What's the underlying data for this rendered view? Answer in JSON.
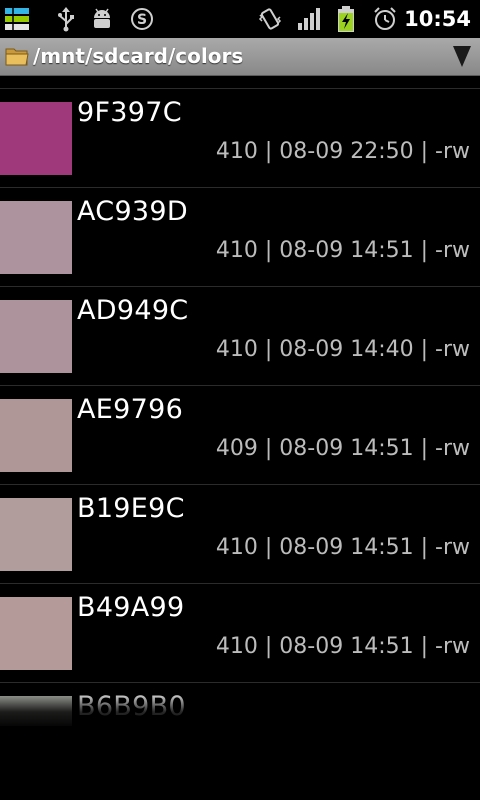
{
  "status_bar": {
    "time": "10:54",
    "icons": [
      "stack-app-icon",
      "usb-icon",
      "android-debug-icon",
      "skype-icon",
      "vibrate-icon",
      "signal-icon",
      "battery-charging-icon",
      "alarm-clock-icon"
    ]
  },
  "path_bar": {
    "path": "/mnt/sdcard/colors",
    "folder_icon": "folder-icon",
    "menu_icon": "dropdown-arrow-icon"
  },
  "files": [
    {
      "name": "9F397C",
      "meta": "410 | 08-09 22:50 | -rw",
      "color": "#9F397C"
    },
    {
      "name": "AC939D",
      "meta": "410 | 08-09 14:51 | -rw",
      "color": "#AC939D"
    },
    {
      "name": "AD949C",
      "meta": "410 | 08-09 14:40 | -rw",
      "color": "#AD949C"
    },
    {
      "name": "AE9796",
      "meta": "409 | 08-09 14:51 | -rw",
      "color": "#AE9796"
    },
    {
      "name": "B19E9C",
      "meta": "410 | 08-09 14:51 | -rw",
      "color": "#B19E9C"
    },
    {
      "name": "B49A99",
      "meta": "410 | 08-09 14:51 | -rw",
      "color": "#B49A99"
    },
    {
      "name": "B6B9B0",
      "color": "#B6B9B0"
    }
  ]
}
